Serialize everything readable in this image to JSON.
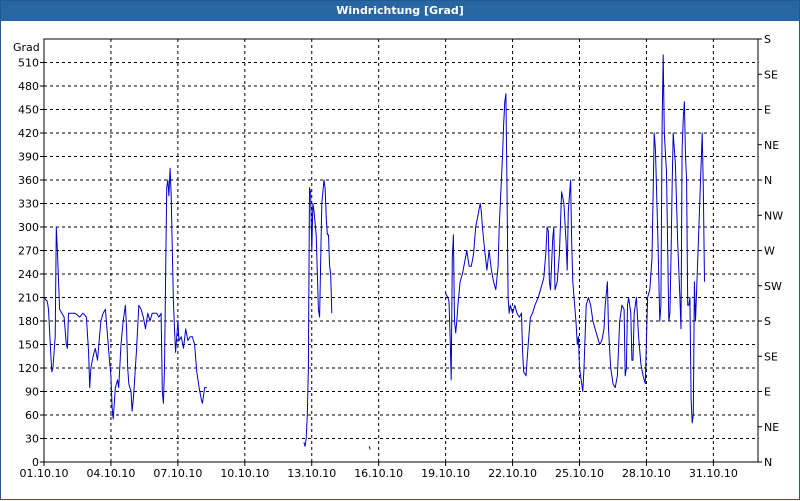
{
  "window": {
    "title": "Windrichtung [Grad]"
  },
  "colors": {
    "title_bar": "#2866a3",
    "series": "#0000cc",
    "grid": "#000000"
  },
  "chart_data": {
    "type": "line",
    "title": "Windrichtung [Grad]",
    "ylabel": "Grad",
    "ylim": [
      0,
      540
    ],
    "xlim": [
      "01.10.10",
      "02.11.10"
    ],
    "grid": true,
    "y_ticks": [
      0,
      30,
      60,
      90,
      120,
      150,
      180,
      210,
      240,
      270,
      300,
      330,
      360,
      390,
      420,
      450,
      480,
      510
    ],
    "x_ticks": [
      "01.10.10",
      "04.10.10",
      "07.10.10",
      "10.10.10",
      "13.10.10",
      "16.10.10",
      "19.10.10",
      "22.10.10",
      "25.10.10",
      "28.10.10",
      "31.10.10"
    ],
    "right_axis": {
      "labels": [
        "N",
        "NE",
        "E",
        "SE",
        "S",
        "SW",
        "W",
        "NW",
        "N",
        "NE",
        "E",
        "SE",
        "S"
      ],
      "values": [
        0,
        45,
        90,
        135,
        180,
        225,
        270,
        315,
        360,
        405,
        450,
        495,
        540
      ]
    },
    "series": [
      {
        "color": "#0000cc",
        "segments": [
          [
            [
              0.0,
              210
            ],
            [
              0.15,
              205
            ],
            [
              0.2,
              195
            ],
            [
              0.3,
              140
            ],
            [
              0.35,
              115
            ],
            [
              0.4,
              120
            ],
            [
              0.5,
              160
            ],
            [
              0.55,
              300
            ],
            [
              0.6,
              270
            ],
            [
              0.7,
              195
            ],
            [
              0.8,
              190
            ],
            [
              0.9,
              185
            ],
            [
              1.0,
              150
            ],
            [
              1.05,
              145
            ],
            [
              1.1,
              190
            ],
            [
              1.2,
              190
            ],
            [
              1.4,
              190
            ],
            [
              1.6,
              185
            ],
            [
              1.75,
              190
            ],
            [
              1.9,
              185
            ],
            [
              2.0,
              140
            ],
            [
              2.05,
              95
            ],
            [
              2.1,
              120
            ],
            [
              2.2,
              135
            ],
            [
              2.3,
              145
            ],
            [
              2.4,
              130
            ],
            [
              2.55,
              180
            ],
            [
              2.65,
              190
            ],
            [
              2.75,
              195
            ],
            [
              2.85,
              160
            ],
            [
              2.95,
              125
            ],
            [
              3.0,
              110
            ],
            [
              3.05,
              70
            ],
            [
              3.1,
              55
            ],
            [
              3.15,
              75
            ],
            [
              3.2,
              95
            ],
            [
              3.3,
              105
            ],
            [
              3.35,
              95
            ],
            [
              3.45,
              150
            ],
            [
              3.55,
              180
            ],
            [
              3.65,
              200
            ],
            [
              3.7,
              170
            ],
            [
              3.75,
              120
            ],
            [
              3.8,
              100
            ],
            [
              3.9,
              90
            ],
            [
              3.95,
              65
            ],
            [
              4.0,
              80
            ],
            [
              4.05,
              100
            ],
            [
              4.15,
              145
            ],
            [
              4.25,
              200
            ],
            [
              4.35,
              195
            ],
            [
              4.45,
              185
            ],
            [
              4.55,
              170
            ],
            [
              4.65,
              190
            ],
            [
              4.75,
              180
            ],
            [
              4.85,
              190
            ],
            [
              4.95,
              190
            ],
            [
              5.05,
              190
            ],
            [
              5.15,
              185
            ],
            [
              5.25,
              190
            ],
            [
              5.3,
              90
            ],
            [
              5.35,
              75
            ],
            [
              5.4,
              120
            ],
            [
              5.5,
              350
            ],
            [
              5.55,
              360
            ],
            [
              5.6,
              340
            ],
            [
              5.65,
              375
            ],
            [
              5.7,
              340
            ],
            [
              5.75,
              270
            ],
            [
              5.8,
              205
            ],
            [
              5.85,
              170
            ],
            [
              5.9,
              140
            ],
            [
              6.0,
              180
            ],
            [
              6.05,
              155
            ],
            [
              6.15,
              160
            ],
            [
              6.25,
              145
            ],
            [
              6.35,
              170
            ],
            [
              6.45,
              155
            ],
            [
              6.55,
              160
            ],
            [
              6.65,
              160
            ],
            [
              6.75,
              150
            ],
            [
              6.85,
              115
            ],
            [
              6.95,
              95
            ],
            [
              7.05,
              80
            ],
            [
              7.1,
              75
            ],
            [
              7.2,
              95
            ],
            [
              7.3,
              95
            ]
          ],
          [
            [
              11.65,
              25
            ],
            [
              11.7,
              20
            ],
            [
              11.75,
              30
            ],
            [
              11.8,
              60
            ],
            [
              11.85,
              120
            ],
            [
              11.9,
              350
            ],
            [
              11.95,
              345
            ],
            [
              12.0,
              270
            ],
            [
              12.05,
              330
            ],
            [
              12.1,
              320
            ],
            [
              12.2,
              290
            ],
            [
              12.3,
              195
            ],
            [
              12.35,
              185
            ],
            [
              12.45,
              330
            ],
            [
              12.55,
              360
            ],
            [
              12.6,
              350
            ],
            [
              12.65,
              310
            ],
            [
              12.7,
              290
            ],
            [
              12.75,
              290
            ],
            [
              12.8,
              250
            ],
            [
              12.85,
              240
            ],
            [
              12.9,
              190
            ]
          ],
          [
            [
              14.58,
              20
            ],
            [
              14.62,
              16
            ]
          ],
          [
            [
              18.0,
              215
            ],
            [
              18.1,
              210
            ],
            [
              18.15,
              205
            ],
            [
              18.2,
              160
            ],
            [
              18.25,
              105
            ],
            [
              18.3,
              260
            ],
            [
              18.35,
              290
            ],
            [
              18.4,
              180
            ],
            [
              18.45,
              165
            ],
            [
              18.5,
              180
            ],
            [
              18.55,
              200
            ],
            [
              18.65,
              230
            ],
            [
              18.75,
              240
            ],
            [
              18.85,
              255
            ],
            [
              18.95,
              270
            ],
            [
              19.05,
              250
            ],
            [
              19.15,
              250
            ],
            [
              19.25,
              265
            ],
            [
              19.35,
              300
            ],
            [
              19.45,
              315
            ],
            [
              19.55,
              330
            ],
            [
              19.6,
              320
            ],
            [
              19.65,
              300
            ],
            [
              19.75,
              270
            ],
            [
              19.85,
              245
            ],
            [
              19.95,
              270
            ],
            [
              20.05,
              245
            ],
            [
              20.15,
              230
            ],
            [
              20.25,
              220
            ],
            [
              20.35,
              250
            ],
            [
              20.4,
              300
            ],
            [
              20.45,
              330
            ],
            [
              20.5,
              360
            ],
            [
              20.55,
              390
            ],
            [
              20.6,
              430
            ],
            [
              20.65,
              460
            ],
            [
              20.7,
              470
            ],
            [
              20.75,
              350
            ],
            [
              20.8,
              210
            ],
            [
              20.85,
              190
            ],
            [
              20.9,
              200
            ],
            [
              21.0,
              190
            ],
            [
              21.1,
              200
            ],
            [
              21.2,
              190
            ],
            [
              21.3,
              185
            ],
            [
              21.4,
              190
            ],
            [
              21.45,
              140
            ],
            [
              21.5,
              115
            ],
            [
              21.6,
              110
            ],
            [
              21.7,
              150
            ],
            [
              21.8,
              185
            ],
            [
              21.9,
              190
            ],
            [
              22.0,
              200
            ],
            [
              22.15,
              210
            ],
            [
              22.3,
              225
            ],
            [
              22.4,
              235
            ],
            [
              22.5,
              270
            ],
            [
              22.55,
              300
            ],
            [
              22.6,
              295
            ],
            [
              22.65,
              230
            ],
            [
              22.7,
              220
            ],
            [
              22.8,
              285
            ],
            [
              22.85,
              300
            ],
            [
              22.9,
              220
            ],
            [
              23.0,
              230
            ],
            [
              23.1,
              265
            ],
            [
              23.2,
              345
            ],
            [
              23.3,
              330
            ],
            [
              23.4,
              280
            ],
            [
              23.45,
              245
            ],
            [
              23.5,
              320
            ],
            [
              23.6,
              360
            ],
            [
              23.65,
              280
            ],
            [
              23.7,
              230
            ],
            [
              23.8,
              195
            ],
            [
              23.85,
              175
            ],
            [
              23.9,
              150
            ],
            [
              23.95,
              160
            ],
            [
              24.0,
              120
            ],
            [
              24.05,
              110
            ],
            [
              24.1,
              100
            ],
            [
              24.15,
              90
            ],
            [
              24.2,
              120
            ],
            [
              24.3,
              200
            ],
            [
              24.4,
              210
            ],
            [
              24.5,
              200
            ],
            [
              24.6,
              180
            ],
            [
              24.7,
              170
            ],
            [
              24.8,
              160
            ],
            [
              24.9,
              150
            ],
            [
              25.0,
              155
            ],
            [
              25.1,
              170
            ],
            [
              25.15,
              200
            ],
            [
              25.25,
              230
            ],
            [
              25.3,
              170
            ],
            [
              25.4,
              120
            ],
            [
              25.5,
              100
            ],
            [
              25.6,
              95
            ],
            [
              25.7,
              110
            ],
            [
              25.8,
              180
            ],
            [
              25.9,
              200
            ],
            [
              26.0,
              195
            ],
            [
              26.05,
              110
            ],
            [
              26.1,
              120
            ],
            [
              26.15,
              200
            ],
            [
              26.2,
              210
            ],
            [
              26.3,
              190
            ],
            [
              26.35,
              130
            ],
            [
              26.4,
              130
            ],
            [
              26.45,
              190
            ],
            [
              26.55,
              210
            ],
            [
              26.65,
              160
            ],
            [
              26.75,
              125
            ],
            [
              26.85,
              110
            ],
            [
              26.95,
              100
            ],
            [
              27.05,
              210
            ],
            [
              27.15,
              220
            ],
            [
              27.25,
              260
            ],
            [
              27.35,
              420
            ],
            [
              27.4,
              400
            ],
            [
              27.5,
              300
            ],
            [
              27.6,
              180
            ],
            [
              27.65,
              200
            ],
            [
              27.7,
              430
            ],
            [
              27.75,
              520
            ],
            [
              27.8,
              420
            ],
            [
              27.9,
              370
            ],
            [
              28.0,
              180
            ],
            [
              28.05,
              190
            ],
            [
              28.1,
              260
            ],
            [
              28.15,
              350
            ],
            [
              28.2,
              420
            ],
            [
              28.3,
              380
            ],
            [
              28.4,
              280
            ],
            [
              28.5,
              210
            ],
            [
              28.55,
              170
            ],
            [
              28.6,
              400
            ],
            [
              28.65,
              440
            ],
            [
              28.7,
              460
            ],
            [
              28.75,
              390
            ],
            [
              28.8,
              360
            ],
            [
              28.85,
              200
            ],
            [
              28.9,
              200
            ],
            [
              28.95,
              210
            ],
            [
              29.0,
              80
            ],
            [
              29.05,
              50
            ],
            [
              29.1,
              60
            ],
            [
              29.15,
              230
            ],
            [
              29.2,
              180
            ],
            [
              29.3,
              260
            ],
            [
              29.4,
              340
            ],
            [
              29.45,
              380
            ],
            [
              29.5,
              420
            ],
            [
              29.55,
              350
            ],
            [
              29.6,
              230
            ]
          ]
        ]
      }
    ]
  }
}
